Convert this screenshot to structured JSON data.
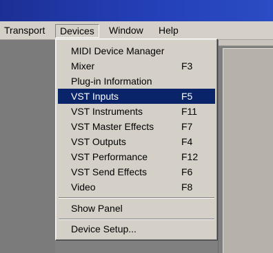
{
  "menubar": {
    "items": [
      {
        "label": "Transport"
      },
      {
        "label": "Devices"
      },
      {
        "label": "Window"
      },
      {
        "label": "Help"
      }
    ]
  },
  "devices_menu": {
    "items": [
      {
        "label": "MIDI Device Manager",
        "shortcut": ""
      },
      {
        "label": "Mixer",
        "shortcut": "F3"
      },
      {
        "label": "Plug-in Information",
        "shortcut": ""
      },
      {
        "label": "VST Inputs",
        "shortcut": "F5",
        "highlighted": true
      },
      {
        "label": "VST Instruments",
        "shortcut": "F11"
      },
      {
        "label": "VST Master Effects",
        "shortcut": "F7"
      },
      {
        "label": "VST Outputs",
        "shortcut": "F4"
      },
      {
        "label": "VST Performance",
        "shortcut": "F12"
      },
      {
        "label": "VST Send Effects",
        "shortcut": "F6"
      },
      {
        "label": "Video",
        "shortcut": "F8"
      },
      {
        "label": "Show Panel",
        "shortcut": ""
      },
      {
        "label": "Device Setup...",
        "shortcut": ""
      }
    ]
  },
  "colors": {
    "highlight": "#0a246a",
    "menu_bg": "#d4d0c8",
    "workspace": "#808080",
    "titlebar": "#1c2f95"
  }
}
